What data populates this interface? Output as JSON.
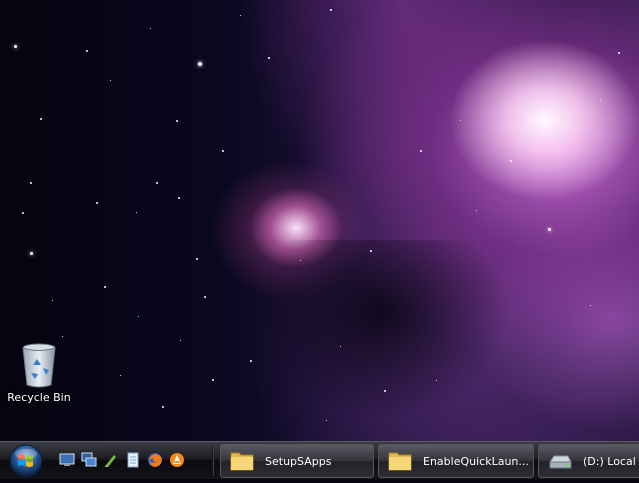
{
  "desktop": {
    "icons": [
      {
        "label": "Recycle Bin",
        "icon": "recycle-bin-icon"
      }
    ]
  },
  "taskbar": {
    "start_icon": "windows-logo-icon",
    "quick_launch": [
      {
        "icon": "show-desktop-icon"
      },
      {
        "icon": "switch-windows-icon"
      },
      {
        "icon": "pen-tool-icon"
      },
      {
        "icon": "notepad-icon"
      },
      {
        "icon": "firefox-icon"
      },
      {
        "icon": "vlc-cone-icon"
      }
    ],
    "buttons": [
      {
        "label": "SetupSApps",
        "icon": "folder-icon"
      },
      {
        "label": "EnableQuickLaun...",
        "icon": "folder-icon"
      },
      {
        "label": "(D:) Local D",
        "icon": "drive-icon"
      }
    ]
  },
  "colors": {
    "taskbar": "#1c1c22",
    "nebula_pink": "#e07ae6",
    "label_text": "#ffffff"
  }
}
